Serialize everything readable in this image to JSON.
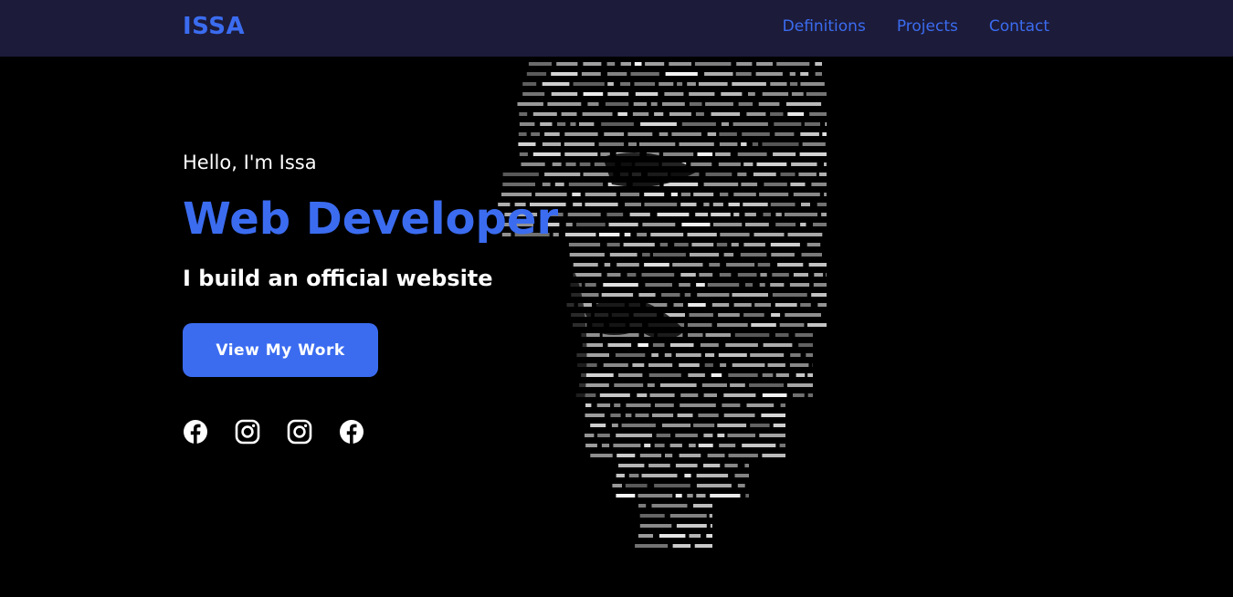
{
  "navbar": {
    "brand": "ISSA",
    "links": [
      {
        "label": "Definitions"
      },
      {
        "label": "Projects"
      },
      {
        "label": "Contact"
      }
    ]
  },
  "hero": {
    "greeting": "Hello, I'm Issa",
    "role": "Web Developer",
    "tagline": "I build an official website",
    "cta_label": "View My Work",
    "socials": [
      {
        "icon": "facebook-icon"
      },
      {
        "icon": "instagram-icon"
      },
      {
        "icon": "instagram-icon"
      },
      {
        "icon": "facebook-icon"
      }
    ],
    "background_image": "masked-face-made-of-code-text"
  },
  "colors": {
    "accent": "#3b6cf0",
    "navbar_bg": "#1c1b3a",
    "page_bg": "#000000",
    "text": "#ffffff"
  }
}
